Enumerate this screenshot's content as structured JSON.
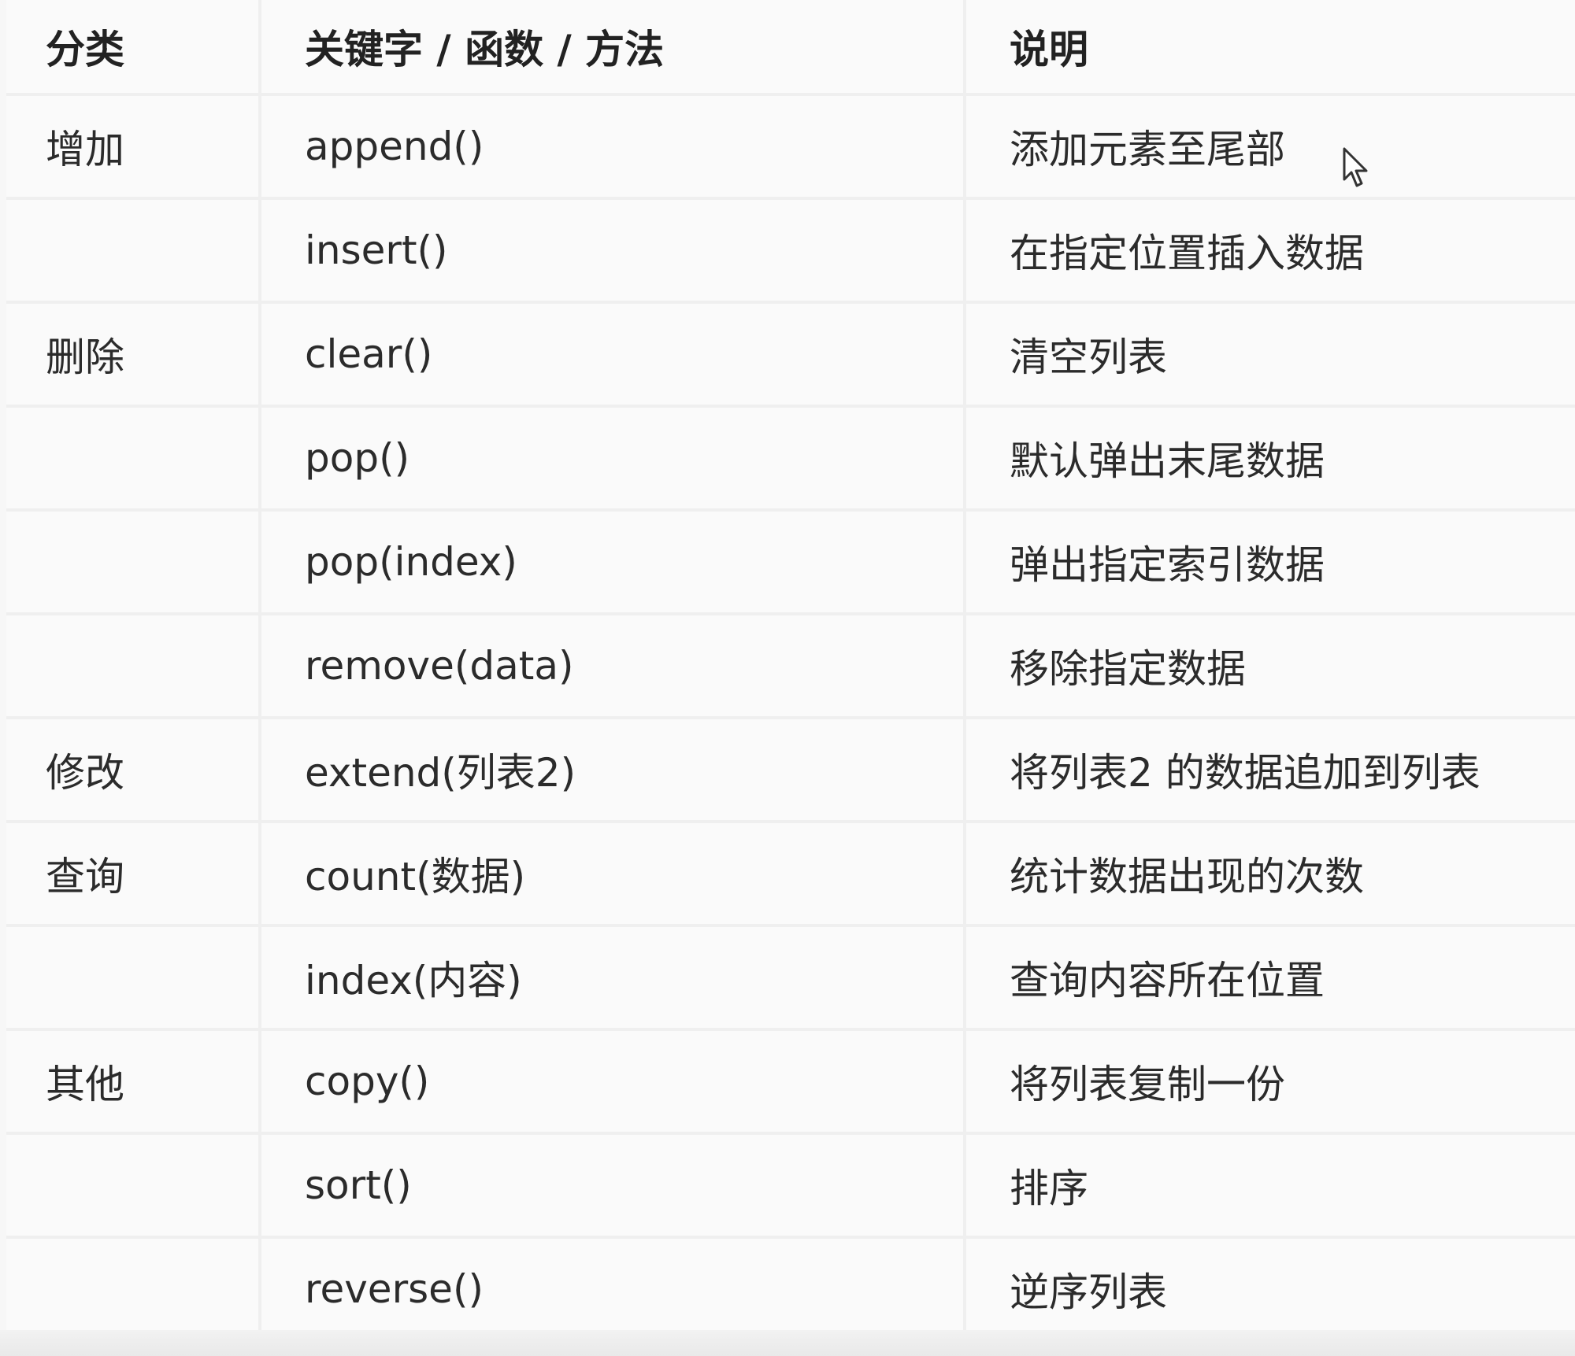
{
  "table": {
    "headers": [
      "分类",
      "关键字 / 函数 / 方法",
      "说明"
    ],
    "rows": [
      {
        "category": "增加",
        "method": "append()",
        "description": "添加元素至尾部"
      },
      {
        "category": "",
        "method": "insert()",
        "description": "在指定位置插入数据"
      },
      {
        "category": "删除",
        "method": "clear()",
        "description": "清空列表"
      },
      {
        "category": "",
        "method": "pop()",
        "description": "默认弹出末尾数据"
      },
      {
        "category": "",
        "method": "pop(index)",
        "description": "弹出指定索引数据"
      },
      {
        "category": "",
        "method": "remove(data)",
        "description": "移除指定数据"
      },
      {
        "category": "修改",
        "method": "extend(列表2)",
        "description": "将列表2 的数据追加到列表"
      },
      {
        "category": "查询",
        "method": "count(数据)",
        "description": "统计数据出现的次数"
      },
      {
        "category": "",
        "method": "index(内容)",
        "description": "查询内容所在位置"
      },
      {
        "category": "其他",
        "method": "copy()",
        "description": "将列表复制一份"
      },
      {
        "category": "",
        "method": "sort()",
        "description": "排序"
      },
      {
        "category": "",
        "method": "reverse()",
        "description": "逆序列表"
      }
    ]
  },
  "cursor": {
    "icon": "mouse-pointer-icon"
  }
}
